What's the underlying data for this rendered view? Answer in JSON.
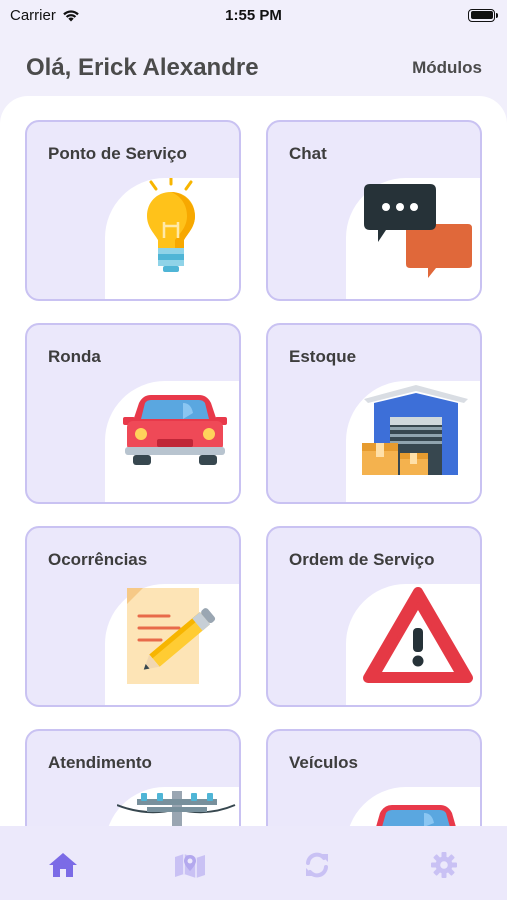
{
  "status_bar": {
    "carrier": "Carrier",
    "time": "1:55 PM"
  },
  "header": {
    "greeting": "Olá, Erick Alexandre",
    "modules_label": "Módulos"
  },
  "modules": [
    {
      "title": "Ponto de Serviço",
      "icon": "lightbulb-icon"
    },
    {
      "title": "Chat",
      "icon": "chat-bubbles-icon"
    },
    {
      "title": "Ronda",
      "icon": "car-icon"
    },
    {
      "title": "Estoque",
      "icon": "warehouse-icon"
    },
    {
      "title": "Ocorrências",
      "icon": "document-pencil-icon"
    },
    {
      "title": "Ordem de Serviço",
      "icon": "warning-icon"
    },
    {
      "title": "Atendimento",
      "icon": "power-pole-icon"
    },
    {
      "title": "Veículos",
      "icon": "vehicle-icon"
    }
  ],
  "tab_bar": {
    "active": "home",
    "tabs": [
      "home-icon",
      "map-icon",
      "sync-icon",
      "settings-icon"
    ]
  },
  "colors": {
    "accent": "#7b6be6",
    "inactive_tab": "#c9c1f4",
    "card_border": "#c9c2f2",
    "card_bg": "#ebe8fb"
  }
}
